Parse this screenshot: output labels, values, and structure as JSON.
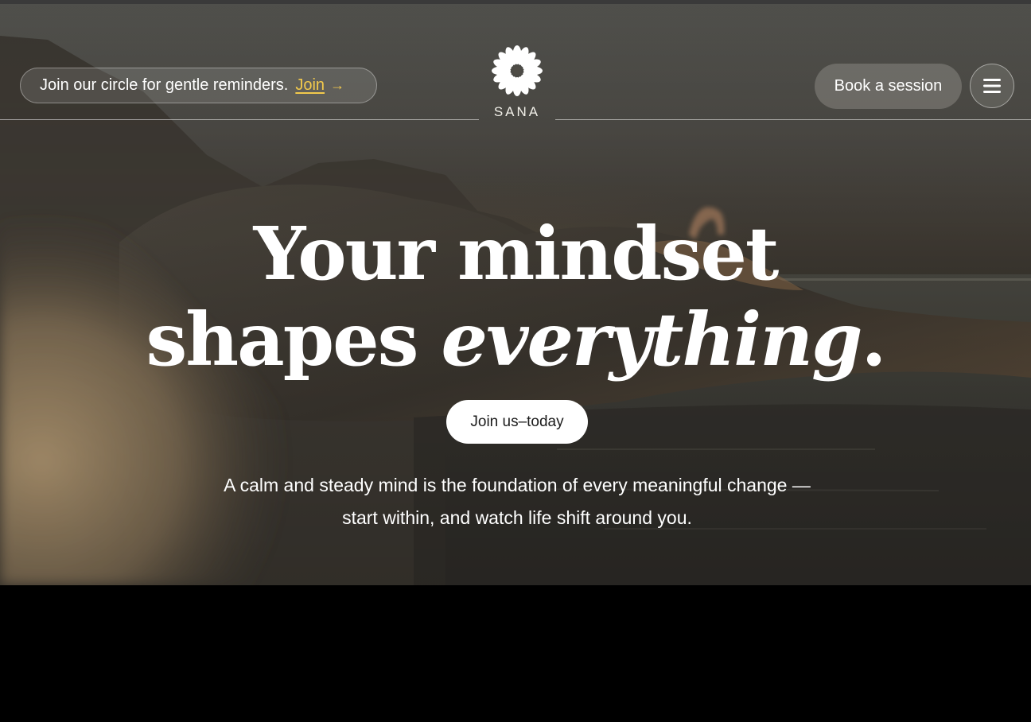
{
  "header": {
    "newsletter_text": "Join our circle for gentle reminders.",
    "newsletter_link": "Join",
    "newsletter_arrow": "→",
    "logo_text": "SANA",
    "book_label": "Book a session",
    "menu_icon": "hamburger-menu-icon"
  },
  "hero": {
    "headline_line1": "Your mindset",
    "headline_line2_plain": "shapes ",
    "headline_line2_italic": "everything",
    "headline_line2_end": ".",
    "cta_label": "Join us–today",
    "subtext": "A calm and steady mind is the foundation of every meaningful change — start within, and watch life shift around you."
  },
  "colors": {
    "link_accent": "#f2c94c",
    "text": "#ffffff",
    "cta_bg": "#ffffff",
    "cta_text": "#1b1b1b",
    "bottom_bg": "#000000"
  }
}
